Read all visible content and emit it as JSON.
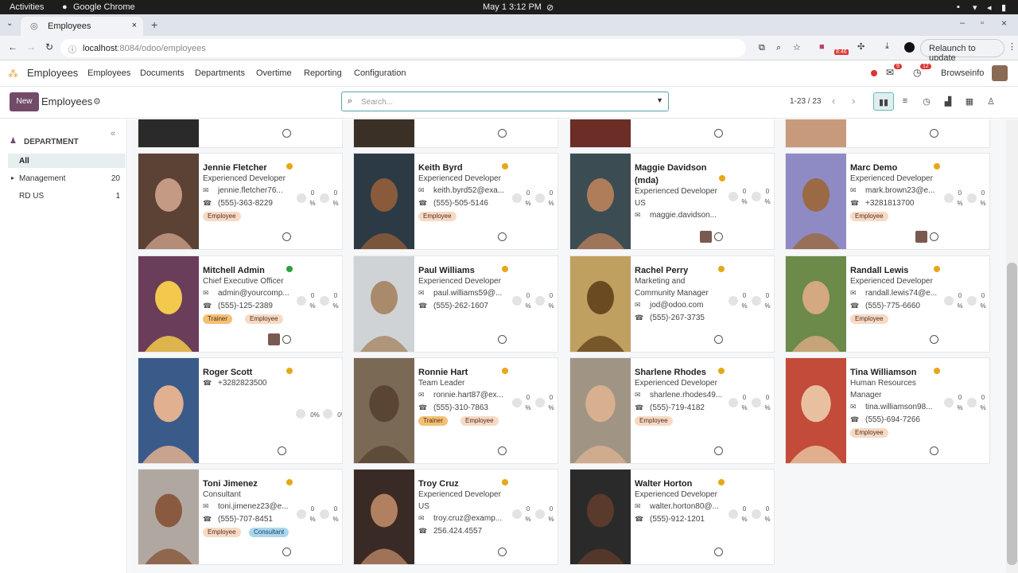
{
  "os": {
    "activities": "Activities",
    "app": "Google Chrome",
    "date": "May 1",
    "time": "3:12 PM"
  },
  "browser": {
    "tab_title": "Employees",
    "url_host": "localhost",
    "url_rest": ":8084/odoo/employees",
    "relaunch": "Relaunch to update",
    "ext_badge": "8:46"
  },
  "nav": {
    "app_name": "Employees",
    "menu": [
      "Employees",
      "Documents",
      "Departments",
      "Overtime",
      "Reporting",
      "Configuration"
    ],
    "chat_count": "9",
    "activity_count": "12",
    "company": "Browseinfo"
  },
  "control": {
    "new_label": "New",
    "title": "Employees",
    "search_placeholder": "Search...",
    "pager": "1-23 / 23"
  },
  "sidebar": {
    "heading": "DEPARTMENT",
    "items": [
      {
        "label": "All",
        "count": ""
      },
      {
        "label": "Management",
        "count": "20"
      },
      {
        "label": "RD US",
        "count": "1"
      }
    ]
  },
  "employees": [
    {
      "name": "Jennie Fletcher",
      "job": "Experienced Developer",
      "lines": [
        "jennie.fletcher76...",
        "(555)-363-8229"
      ],
      "tags": [
        "Employee"
      ],
      "status": "#e6a817"
    },
    {
      "name": "Keith Byrd",
      "job": "Experienced Developer",
      "lines": [
        "keith.byrd52@exa...",
        "(555)-505-5146"
      ],
      "tags": [
        "Employee"
      ],
      "status": "#e6a817"
    },
    {
      "name": "Maggie Davidson (mda)",
      "job": "Experienced Developer",
      "job2": "US",
      "lines": [
        "maggie.davidson..."
      ],
      "tags": [],
      "status": "#e6a817"
    },
    {
      "name": "Marc Demo",
      "job": "Experienced Developer",
      "lines": [
        "mark.brown23@e...",
        "+3281813700"
      ],
      "tags": [
        "Employee"
      ],
      "status": "#e6a817"
    },
    {
      "name": "Mitchell Admin",
      "job": "Chief Executive Officer",
      "lines": [
        "admin@yourcomp...",
        "(555)-125-2389"
      ],
      "tags": [
        "Trainer",
        "Employee"
      ],
      "status": "#2ea043"
    },
    {
      "name": "Paul Williams",
      "job": "Experienced Developer",
      "lines": [
        "paul.williams59@...",
        "(555)-262-1607"
      ],
      "tags": [],
      "status": "#e6a817"
    },
    {
      "name": "Rachel Perry",
      "job": "Marketing and",
      "job2": "Community Manager",
      "lines": [
        "jod@odoo.com",
        "(555)-267-3735"
      ],
      "tags": [],
      "status": "#e6a817"
    },
    {
      "name": "Randall Lewis",
      "job": "Experienced Developer",
      "lines": [
        "randall.lewis74@e...",
        "(555)-775-6660"
      ],
      "tags": [
        "Employee"
      ],
      "status": "#e6a817"
    },
    {
      "name": "Roger Scott",
      "job": "",
      "lines": [
        "+3282823500"
      ],
      "tags": [],
      "status": "#e6a817"
    },
    {
      "name": "Ronnie Hart",
      "job": "Team Leader",
      "lines": [
        "ronnie.hart87@ex...",
        "(555)-310-7863"
      ],
      "tags": [
        "Trainer",
        "Employee"
      ],
      "status": "#e6a817"
    },
    {
      "name": "Sharlene Rhodes",
      "job": "Experienced Developer",
      "lines": [
        "sharlene.rhodes49...",
        "(555)-719-4182"
      ],
      "tags": [
        "Employee"
      ],
      "status": "#e6a817"
    },
    {
      "name": "Tina Williamson",
      "job": "Human Resources",
      "job2": "Manager",
      "lines": [
        "tina.williamson98...",
        "(555)-694-7266"
      ],
      "tags": [
        "Employee"
      ],
      "status": "#e6a817"
    },
    {
      "name": "Toni Jimenez",
      "job": "Consultant",
      "lines": [
        "toni.jimenez23@e...",
        "(555)-707-8451"
      ],
      "tags": [
        "Employee",
        "Consultant"
      ],
      "status": "#e6a817"
    },
    {
      "name": "Troy Cruz",
      "job": "Experienced Developer",
      "job2": "US",
      "lines": [
        "troy.cruz@examp...",
        "256.424.4557"
      ],
      "tags": [],
      "status": "#e6a817"
    },
    {
      "name": "Walter Horton",
      "job": "Experienced Developer",
      "lines": [
        "walter.horton80@...",
        "(555)-912-1201"
      ],
      "tags": [],
      "status": "#e6a817"
    }
  ],
  "pct": {
    "zero": "0",
    "percent": "%",
    "inline": "0%"
  }
}
